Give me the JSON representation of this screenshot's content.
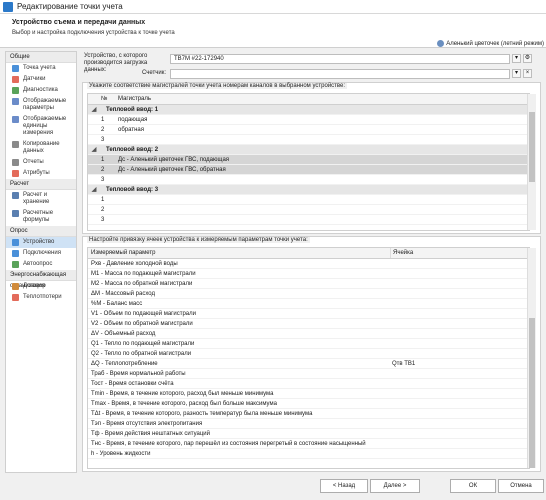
{
  "window": {
    "title": "Редактирование точки учета"
  },
  "header": {
    "title": "Устройство съема и передачи данных",
    "subtitle": "Выбор и настройка подключения устройства к точке учета",
    "user": "Аленький цветочек (летний режим)"
  },
  "sidebar": {
    "sections": [
      {
        "title": "Общие",
        "items": [
          {
            "label": "Точка учета",
            "icon": "gear-icon",
            "color": "#4a90d9"
          },
          {
            "label": "Датчики",
            "icon": "sensor-icon",
            "color": "#e36b5b"
          },
          {
            "label": "Диагностика",
            "icon": "diagnostics-icon",
            "color": "#5aa35a"
          },
          {
            "label": "Отображаемые параметры",
            "icon": "params-icon",
            "color": "#6b8cc9"
          },
          {
            "label": "Отображаемые единицы измерения",
            "icon": "units-icon",
            "color": "#6b8cc9"
          },
          {
            "label": "Копирование данных",
            "icon": "copy-icon",
            "color": "#8a8a8a"
          },
          {
            "label": "Отчеты",
            "icon": "report-icon",
            "color": "#8a8a8a"
          },
          {
            "label": "Атрибуты",
            "icon": "attributes-icon",
            "color": "#e36b5b"
          }
        ]
      },
      {
        "title": "Расчет",
        "items": [
          {
            "label": "Расчет и хранение",
            "icon": "calc-icon",
            "color": "#5a7fb0"
          },
          {
            "label": "Расчетные формулы",
            "icon": "formula-icon",
            "color": "#5a7fb0"
          }
        ]
      },
      {
        "title": "Опрос",
        "items": [
          {
            "label": "Устройство",
            "icon": "device-icon",
            "color": "#4a90d9"
          },
          {
            "label": "Подключения",
            "icon": "connection-icon",
            "color": "#4a90d9"
          },
          {
            "label": "Автоопрос",
            "icon": "autopoll-icon",
            "color": "#5aa35a"
          }
        ]
      },
      {
        "title": "Энергоснабжающая организация",
        "items": [
          {
            "label": "Договор",
            "icon": "contract-icon",
            "color": "#d08a3a"
          },
          {
            "label": "Теплотпотери",
            "icon": "heat-loss-icon",
            "color": "#e36b5b"
          }
        ]
      }
    ]
  },
  "device": {
    "label": "Устройство, с которого производится загрузка данных:",
    "value": "ТВ7М #22-172940"
  },
  "meter": {
    "label": "Счетчик:",
    "value": ""
  },
  "channels": {
    "title": "Укажите соответствие магистралей точки учета номерам каналов в выбранном устройстве:",
    "headers": [
      "№",
      "Магистраль"
    ],
    "groups": [
      {
        "name": "Тепловой ввод: 1",
        "rows": [
          {
            "n": "1",
            "m": "подающая"
          },
          {
            "n": "2",
            "m": "обратная"
          },
          {
            "n": "3",
            "m": ""
          }
        ]
      },
      {
        "name": "Тепловой ввод: 2",
        "rows": [
          {
            "n": "1",
            "m": "Дс - Аленький цветочек ГВС, подающая"
          },
          {
            "n": "2",
            "m": "Дс - Аленький цветочек ГВС, обратная"
          },
          {
            "n": "3",
            "m": ""
          }
        ]
      },
      {
        "name": "Тепловой ввод: 3",
        "rows": [
          {
            "n": "1",
            "m": ""
          },
          {
            "n": "2",
            "m": ""
          },
          {
            "n": "3",
            "m": ""
          }
        ]
      }
    ]
  },
  "cells": {
    "title": "Настройте привязку ячеек устройства к измеряемым параметрам точки учета:",
    "headers": [
      "Измеряемый параметр",
      "Ячейка"
    ],
    "rows": [
      {
        "p": "Рхв - Давление холодной воды",
        "c": ""
      },
      {
        "p": "M1 - Масса по подающей магистрали",
        "c": ""
      },
      {
        "p": "M2 - Масса по обратной магистрали",
        "c": ""
      },
      {
        "p": "ΔM - Массовый расход",
        "c": ""
      },
      {
        "p": "%M - Баланс масс",
        "c": ""
      },
      {
        "p": "V1 - Объем по подающей магистрали",
        "c": ""
      },
      {
        "p": "V2 - Объем по обратной магистрали",
        "c": ""
      },
      {
        "p": "ΔV - Объемный расход",
        "c": ""
      },
      {
        "p": "Q1 - Тепло по подающей магистрали",
        "c": ""
      },
      {
        "p": "Q2 - Тепло по обратной магистрали",
        "c": ""
      },
      {
        "p": "ΔQ - Теплопотребление",
        "c": "Qтв ТВ1"
      },
      {
        "p": "Траб - Время нормальной работы",
        "c": ""
      },
      {
        "p": "Тост - Время остановки счёта",
        "c": ""
      },
      {
        "p": "Тmin - Время, в течение которого, расход был меньше минимума",
        "c": ""
      },
      {
        "p": "Тmax - Время, в течение которого, расход был больше максимума",
        "c": ""
      },
      {
        "p": "ТΔt - Время, в течение которого, разность температур была меньше минимума",
        "c": ""
      },
      {
        "p": "Тэп - Время отсутствия электропитания",
        "c": ""
      },
      {
        "p": "Тф - Время действия нештатных ситуаций",
        "c": ""
      },
      {
        "p": "Тнс - Время, в течение которого, пар перешёл из состояния перегретый в состояние насыщенный",
        "c": ""
      },
      {
        "p": "h - Уровень жидкости",
        "c": ""
      }
    ]
  },
  "footer": {
    "back": "< Назад",
    "next": "Далее >",
    "ok": "ОК",
    "cancel": "Отмена"
  }
}
